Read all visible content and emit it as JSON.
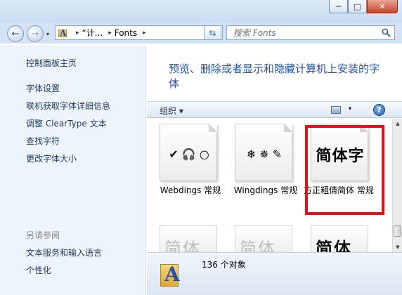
{
  "window": {
    "caption_min": "─",
    "caption_max": "□",
    "caption_close": "✕"
  },
  "nav": {
    "back": "←",
    "forward": "→",
    "history": "▾"
  },
  "address": {
    "crumbs": [
      "“计...",
      "Fonts"
    ],
    "separator": "▸",
    "dropdown": "▾",
    "refresh": "⇆"
  },
  "search": {
    "placeholder": "搜索 Fonts"
  },
  "sidebar": {
    "home": "控制面板主页",
    "links": [
      "字体设置",
      "联机获取字体详细信息",
      "调整 ClearType 文本",
      "查找字符",
      "更改字体大小"
    ],
    "see_also": "另请参阅",
    "see_also_links": [
      "文本服务和输入语言",
      "个性化"
    ]
  },
  "main": {
    "heading": "预览、删除或者显示和隐藏计算机上安装的字体",
    "toolbar": {
      "organize": "组织 ▾",
      "view_dropdown": "▾",
      "help": "?"
    },
    "fonts": [
      {
        "preview": "✔ 🎧 ○",
        "label": "Webdings 常规"
      },
      {
        "preview": "❄ ✵ ✎",
        "label": "Wingdings 常规"
      },
      {
        "preview": "简体字",
        "label": "方正粗倩简体 常规"
      }
    ],
    "ghost_row": [
      "简体字",
      "简体字",
      "简体字"
    ],
    "status": {
      "count": "136 个对象"
    }
  },
  "scrollbar": {
    "up": "▲",
    "down": "▼"
  },
  "colors": {
    "selection_outline": "#e0121b",
    "heading": "#1e50a2",
    "link": "#1e395b"
  }
}
